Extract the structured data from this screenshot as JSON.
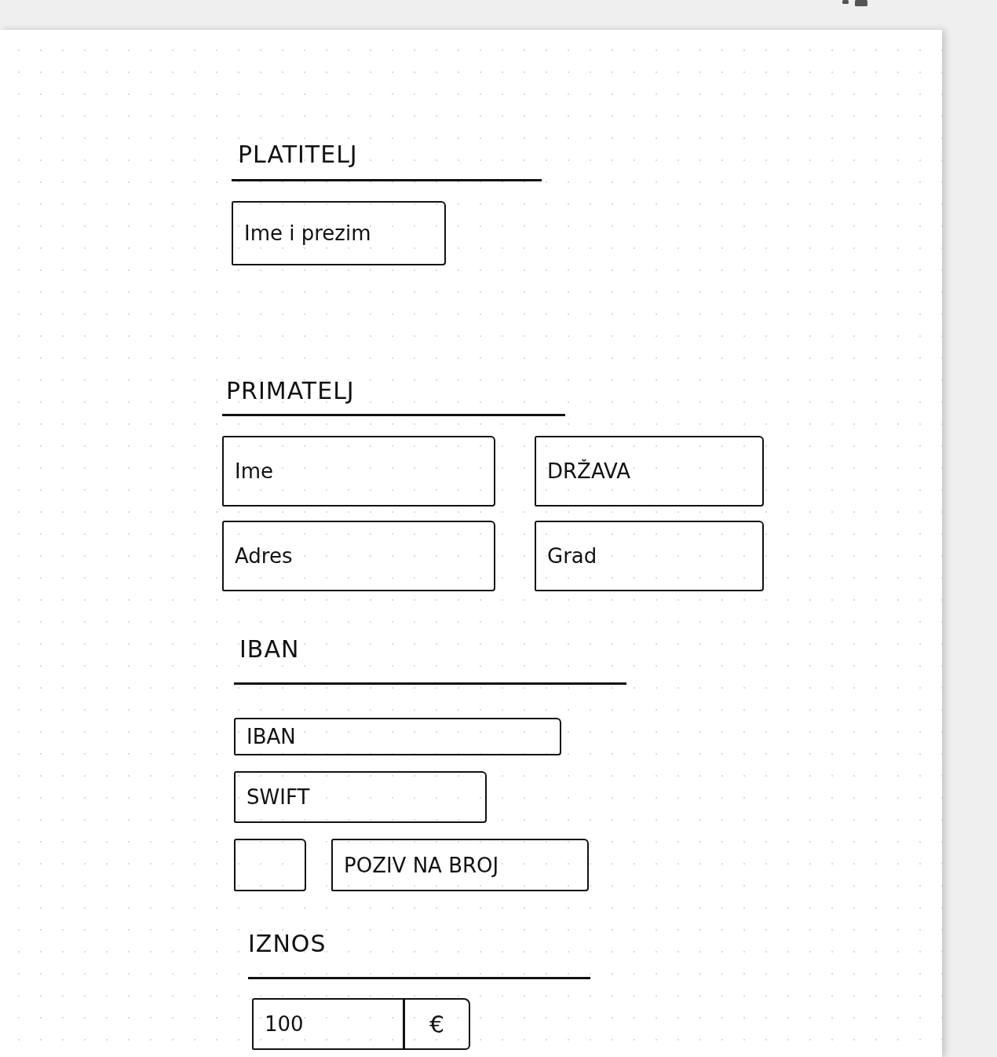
{
  "top_bar": {
    "icons": [
      {
        "kind": "small"
      },
      {
        "kind": "wide"
      }
    ]
  },
  "sections": [
    {
      "heading": "PLATITELJ",
      "rows": [
        [
          {
            "kind": "input",
            "placeholder": "Ime i prezim"
          }
        ]
      ]
    },
    {
      "heading": "PRIMATELJ",
      "rows": [
        [
          {
            "kind": "input",
            "placeholder": "Ime"
          },
          {
            "kind": "input",
            "placeholder": "DRŽAVA"
          }
        ],
        [
          {
            "kind": "input",
            "placeholder": "Adres"
          },
          {
            "kind": "input",
            "placeholder": "Grad"
          }
        ]
      ]
    },
    {
      "heading": "IBAN",
      "rows": [
        [
          {
            "kind": "input",
            "placeholder": "IBAN"
          }
        ],
        [
          {
            "kind": "input",
            "placeholder": "SWIFT"
          }
        ],
        [
          {
            "kind": "input"
          },
          {
            "kind": "input",
            "placeholder": "POZIV NA BROJ"
          }
        ]
      ]
    },
    {
      "heading": "IZNOS",
      "rows": [
        [
          {
            "kind": "amount",
            "value": "100",
            "currency": "€"
          }
        ]
      ]
    }
  ]
}
